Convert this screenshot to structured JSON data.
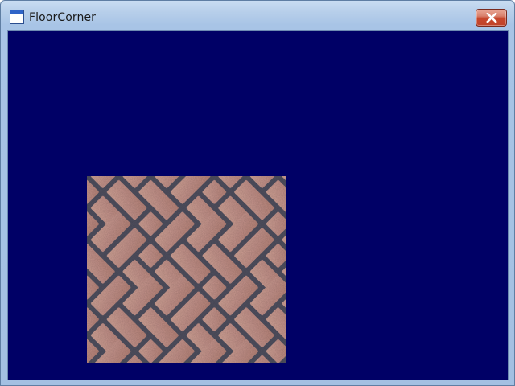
{
  "window": {
    "title": "FloorCorner",
    "icons": {
      "app": "window-app-icon",
      "close": "close-icon"
    }
  },
  "viewport": {
    "background_color": "#000066",
    "texture": {
      "name": "herringbone-brick-floor",
      "brick_color": "#c69589",
      "mortar_color": "#545461"
    }
  }
}
